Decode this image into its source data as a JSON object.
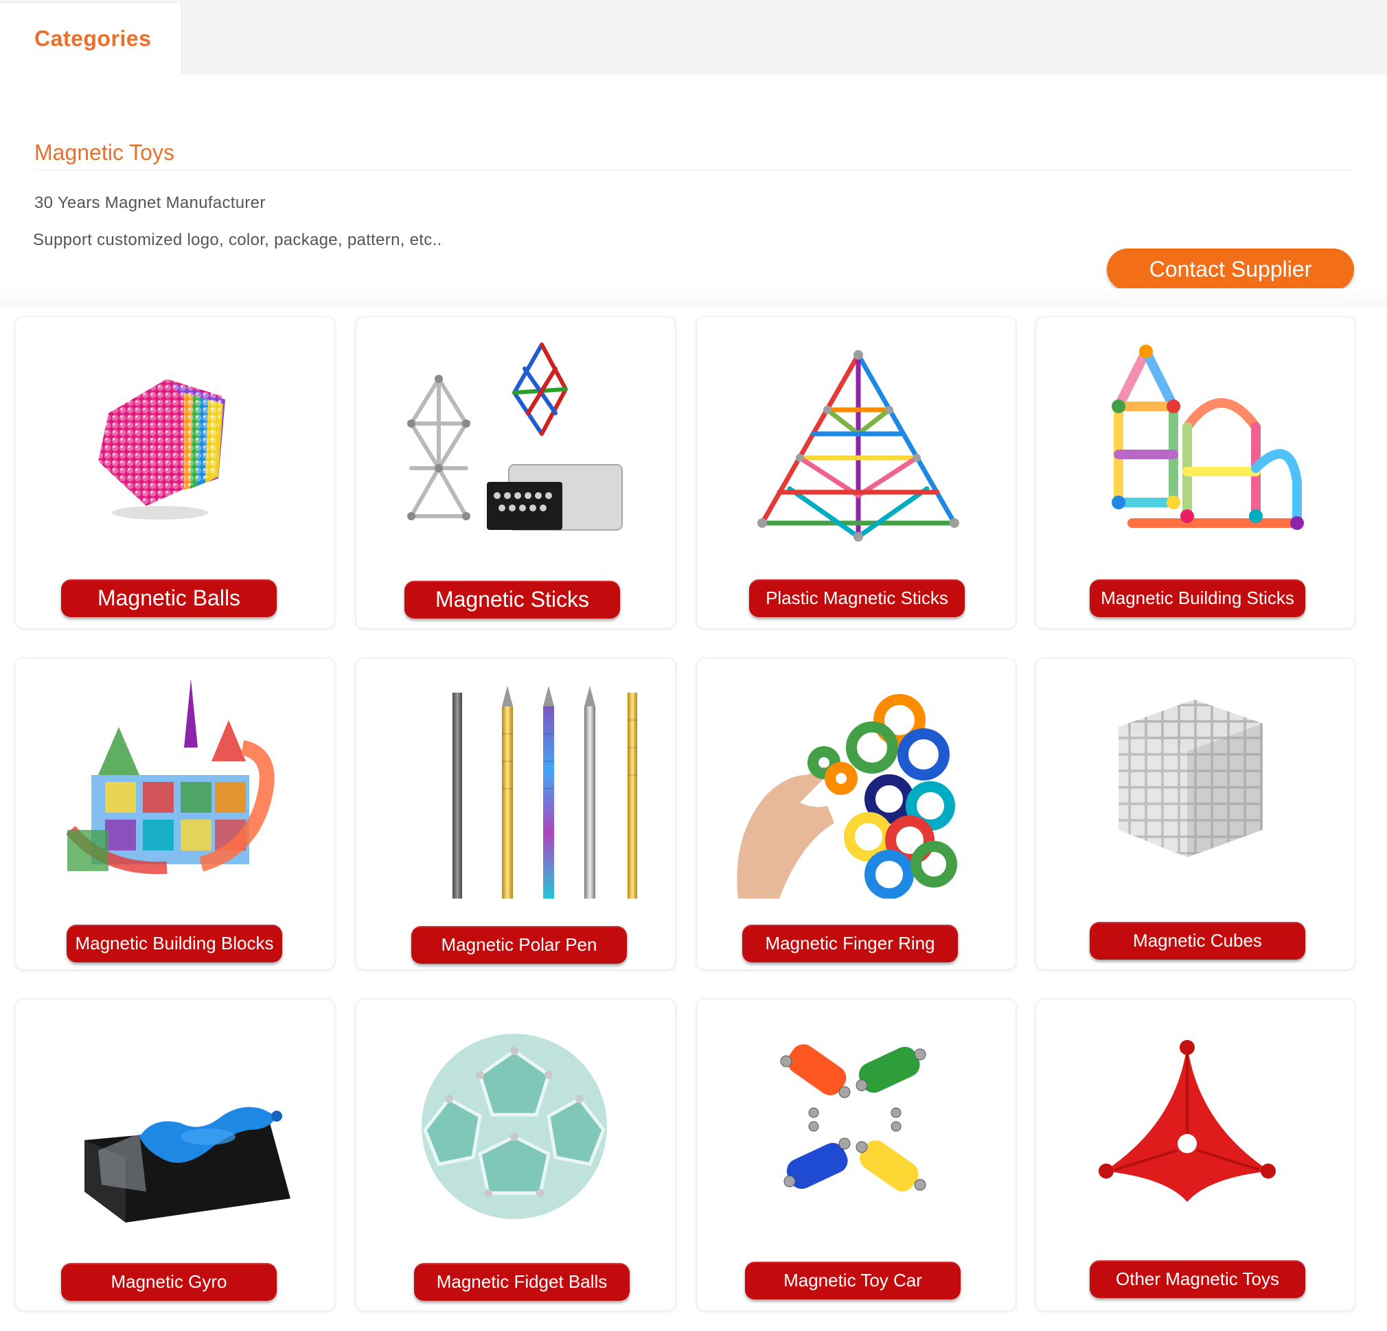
{
  "tabs": {
    "active_label": "Categories"
  },
  "header": {
    "title": "Magnetic Toys",
    "line1": "30 Years Magnet Manufacturer",
    "line2": "Support customized logo, color, package, pattern, etc..",
    "contact_label": "Contact Supplier"
  },
  "categories": [
    {
      "label": "Magnetic Balls",
      "icon": "magnetic-balls-image"
    },
    {
      "label": "Magnetic Sticks",
      "icon": "magnetic-sticks-image"
    },
    {
      "label": "Plastic Magnetic Sticks",
      "icon": "plastic-magnetic-sticks-image"
    },
    {
      "label": "Magnetic Building Sticks",
      "icon": "magnetic-building-sticks-image"
    },
    {
      "label": "Magnetic Building Blocks",
      "icon": "magnetic-building-blocks-image"
    },
    {
      "label": "Magnetic Polar Pen",
      "icon": "magnetic-polar-pen-image"
    },
    {
      "label": "Magnetic Finger Ring",
      "icon": "magnetic-finger-ring-image"
    },
    {
      "label": "Magnetic Cubes",
      "icon": "magnetic-cubes-image"
    },
    {
      "label": "Magnetic Gyro",
      "icon": "magnetic-gyro-image"
    },
    {
      "label": "Magnetic Fidget Balls",
      "icon": "magnetic-fidget-balls-image"
    },
    {
      "label": "Magnetic Toy Car",
      "icon": "magnetic-toy-car-image"
    },
    {
      "label": "Other Magnetic Toys",
      "icon": "other-magnetic-toys-image"
    }
  ],
  "colors": {
    "accent": "#e8702a",
    "button": "#f26f17",
    "label_bg": "#c30b0d"
  }
}
